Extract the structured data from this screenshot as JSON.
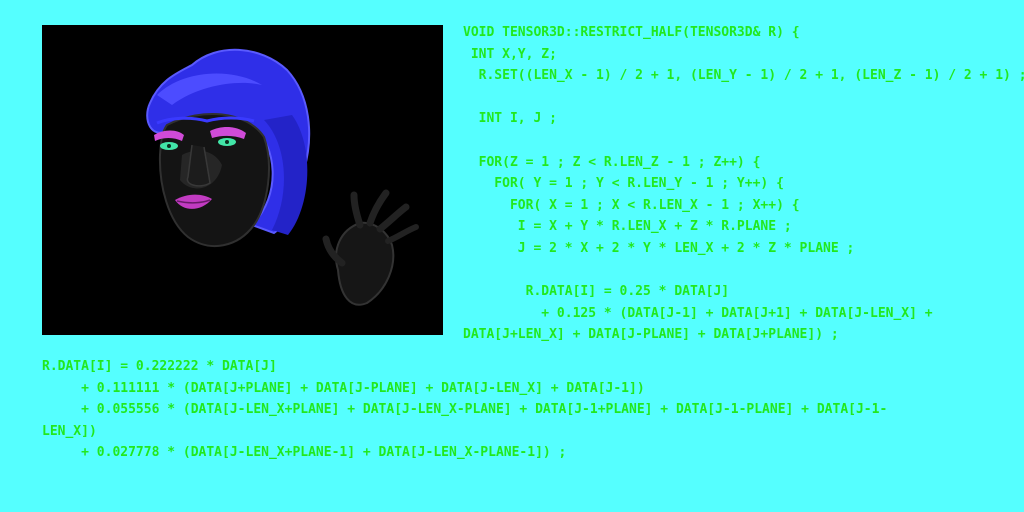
{
  "colors": {
    "background": "#55ffff",
    "code_text": "#22e81e",
    "viewport_background": "#000000",
    "hair": "#3a3aff",
    "face": "#141414",
    "lips": "#c23bc2",
    "eye_shadow": "#d04bd8",
    "eye_iris": "#42e6a8"
  },
  "viewport": {
    "content": [
      "face-render",
      "hand-render"
    ]
  },
  "code_top": [
    "void Tensor3D::restrict_half(Tensor3D& r) {",
    " int x,y, z;",
    "  r.set((len_x - 1) / 2 + 1, (len_y - 1) / 2 + 1, (len_z - 1) / 2 + 1) ;",
    "",
    "  int i, j ;",
    "",
    "  for(z = 1 ; z < r.len_z - 1 ; z++) {",
    "    for( y = 1 ; y < r.len_y - 1 ; y++) {",
    "      for( x = 1 ; x < r.len_x - 1 ; x++) {",
    "       i = x + y * r.len_x + z * r.plane ;",
    "       j = 2 * x + 2 * y * len_x + 2 * z * plane ;",
    "",
    "        r.data[i] = 0.25 * data[j]",
    "          + 0.125 * (data[j-1] + data[j+1] + data[j-len_x] +",
    "data[j+len_x] + data[j-plane] + data[j+plane]) ;"
  ],
  "code_bottom": [
    "r.data[i] = 0.222222 * data[j]",
    "     + 0.111111 * (data[j+plane] + data[j-plane] + data[j-len_x] + data[j-1])",
    "     + 0.055556 * (data[j-len_x+plane] + data[j-len_x-plane] + data[j-1+plane] + data[j-1-plane] + data[j-1-",
    "len_x])",
    "     + 0.027778 * (data[j-len_x+plane-1] + data[j-len_x-plane-1]) ;"
  ]
}
